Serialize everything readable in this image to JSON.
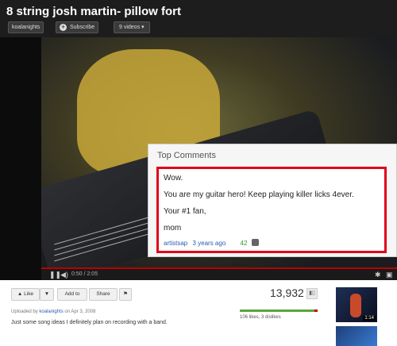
{
  "header": {
    "title": "8 string josh martin- pillow fort",
    "channel": "koalanights",
    "subscribe": "Subscribe",
    "videos": "9 videos"
  },
  "player": {
    "time": "0:50 / 2:05",
    "progress_fraction": 0.4
  },
  "comments": {
    "heading": "Top Comments",
    "lines": [
      "Wow.",
      "You are my guitar hero! Keep playing killer licks 4ever.",
      "Your #1 fan,",
      "mom"
    ],
    "author": "artistsap",
    "date": "3 years ago",
    "votes": "42"
  },
  "below": {
    "like": "Like",
    "add_to": "Add to",
    "share": "Share",
    "views": "13,932",
    "likes_text": "106 likes, 3 dislikes",
    "uploaded_prefix": "Uploaded by",
    "uploader": "koalanights",
    "uploaded_suffix": "on Apr 3, 2008",
    "description": "Just some song ideas I definitely plan on recording with a band.",
    "related_duration": "1:14"
  }
}
